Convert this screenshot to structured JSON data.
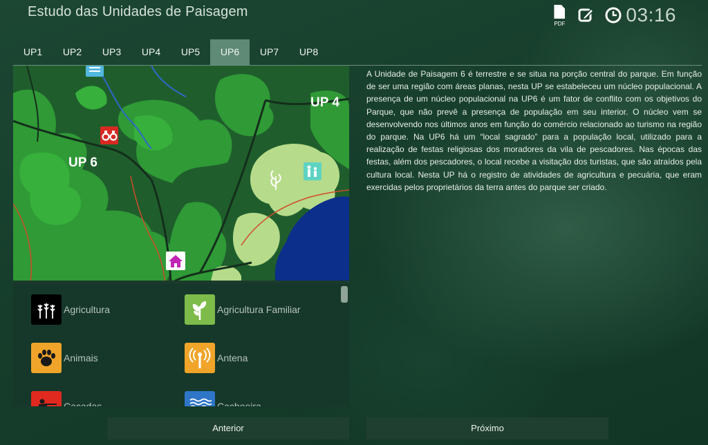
{
  "header": {
    "title": "Estudo das Unidades de Paisagem",
    "pdf_label": "PDF",
    "time": "03:16",
    "icons": [
      "pdf-icon",
      "edit-icon",
      "clock-icon"
    ]
  },
  "tabs": [
    {
      "label": "UP1",
      "active": false
    },
    {
      "label": "UP2",
      "active": false
    },
    {
      "label": "UP3",
      "active": false
    },
    {
      "label": "UP4",
      "active": false
    },
    {
      "label": "UP5",
      "active": false
    },
    {
      "label": "UP6",
      "active": true
    },
    {
      "label": "UP7",
      "active": false
    },
    {
      "label": "UP8",
      "active": false
    }
  ],
  "map": {
    "label_up6": "UP 6",
    "label_up4": "UP 4",
    "markers": [
      "binoculars-icon",
      "waterfall-icon",
      "house-icon",
      "family-icon",
      "wheat-icon"
    ]
  },
  "legend": {
    "items": [
      {
        "label": "Agricultura",
        "icon": "wheat-icon",
        "color": "#000000"
      },
      {
        "label": "Agricultura Familiar",
        "icon": "sprout-icon",
        "color": "#7dbb4a"
      },
      {
        "label": "Animais",
        "icon": "paw-icon",
        "color": "#f0a52a"
      },
      {
        "label": "Antena",
        "icon": "antenna-icon",
        "color": "#f0a52a"
      },
      {
        "label": "Caçadas",
        "icon": "hunter-icon",
        "color": "#e02a1f"
      },
      {
        "label": "Cachoeira",
        "icon": "waves-icon",
        "color": "#2f76c7"
      }
    ]
  },
  "description": "A Unidade de Paisagem 6 é terrestre e se situa na porção central do parque. Em função de ser uma região com áreas planas, nesta UP se estabeleceu um núcleo populacional. A presença de um núcleo populacional na UP6 é um fator de conflito com os objetivos do Parque, que não prevê a presença de população em seu interior. O núcleo vem se desenvolvendo nos últimos anos em função do comércio relacionado ao turismo na região do parque.  Na UP6 há um “local sagrado” para a população local, utilizado para a realização de festas religiosas dos moradores da vila de pescadores. Nas épocas das festas, além dos pescadores, o local recebe a visitação dos turistas, que são atraídos pela cultura local. Nesta UP há o registro de atividades de agricultura e pecuária, que eram exercidas pelos proprietários da terra antes do parque ser criado.",
  "buttons": {
    "prev": "Anterior",
    "next": "Próximo"
  },
  "colors": {
    "accent_tab": "#5f8a76",
    "map_forest_dark": "#1d5a2a",
    "map_forest_light": "#33a83a",
    "map_field": "#b9dd8e",
    "map_water": "#0b2f8a"
  }
}
